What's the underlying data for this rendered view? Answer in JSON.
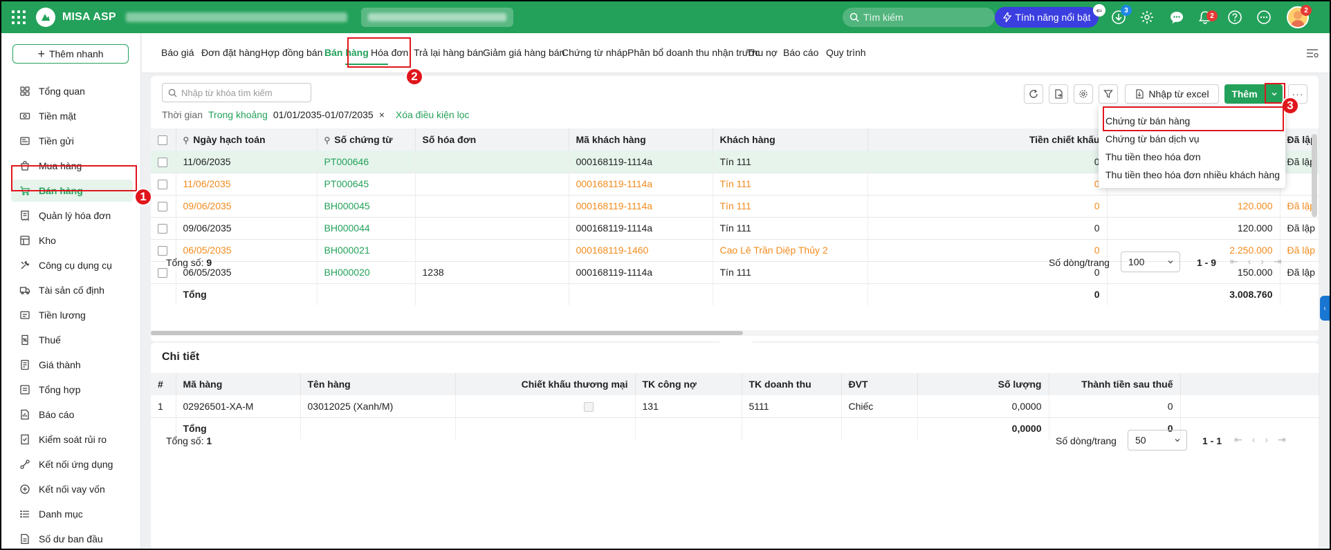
{
  "app": {
    "name": "MISA ASP"
  },
  "topbar": {
    "search_placeholder": "Tìm kiếm",
    "feature_label": "Tính năng nổi bật",
    "download_badge": "3",
    "notification_badge": "2",
    "avatar_badge": "2",
    "colors": {
      "brand": "#23a15a",
      "feature": "#3b3fe0",
      "badge": "#e53935",
      "download_badge": "#1e88e5"
    }
  },
  "sidebar": {
    "quick_add": "Thêm nhanh",
    "items": [
      {
        "label": "Tổng quan",
        "icon": "overview-icon"
      },
      {
        "label": "Tiền mặt",
        "icon": "cash-icon"
      },
      {
        "label": "Tiền gửi",
        "icon": "bank-icon"
      },
      {
        "label": "Mua hàng",
        "icon": "shopping-bag-icon"
      },
      {
        "label": "Bán hàng",
        "icon": "cart-icon"
      },
      {
        "label": "Quản lý hóa đơn",
        "icon": "invoice-icon"
      },
      {
        "label": "Kho",
        "icon": "warehouse-icon"
      },
      {
        "label": "Công cụ dụng cụ",
        "icon": "tools-icon"
      },
      {
        "label": "Tài sản cố định",
        "icon": "truck-icon"
      },
      {
        "label": "Tiền lương",
        "icon": "payroll-icon"
      },
      {
        "label": "Thuế",
        "icon": "tax-icon"
      },
      {
        "label": "Giá thành",
        "icon": "cost-icon"
      },
      {
        "label": "Tổng hợp",
        "icon": "summary-icon"
      },
      {
        "label": "Báo cáo",
        "icon": "report-icon"
      },
      {
        "label": "Kiểm soát rủi ro",
        "icon": "risk-icon"
      },
      {
        "label": "Kết nối ứng dụng",
        "icon": "connect-icon"
      },
      {
        "label": "Kết nối vay vốn",
        "icon": "loan-icon"
      },
      {
        "label": "Danh mục",
        "icon": "list-icon"
      },
      {
        "label": "Số dư ban đầu",
        "icon": "balance-icon"
      }
    ]
  },
  "tabs": [
    "Báo giá",
    "Đơn đặt hàng",
    "Hợp đồng bán",
    "Bán hàng",
    "Hóa đơn",
    "Trả lại hàng bán",
    "Giảm giá hàng bán",
    "Chứng từ nháp",
    "Phân bổ doanh thu nhận trước",
    "Thu nợ",
    "Báo cáo",
    "Quy trình"
  ],
  "toolbar": {
    "search_placeholder": "Nhập từ khóa tìm kiếm",
    "excel_label": "Nhập từ excel",
    "add_label": "Thêm",
    "more_label": "···"
  },
  "filter": {
    "label": "Thời gian",
    "mode": "Trong khoảng",
    "range": "01/01/2035-01/07/2035",
    "clear_x": "×",
    "clear_label": "Xóa điều kiện lọc"
  },
  "dropdown": {
    "options": [
      "Chứng từ bán hàng",
      "Chứng từ bán dịch vụ",
      "Thu tiền theo hóa đơn",
      "Thu tiền theo hóa đơn nhiều khách hàng"
    ]
  },
  "main_table": {
    "headers": [
      "Ngày hạch toán",
      "Số chứng từ",
      "Số hóa đơn",
      "Mã khách hàng",
      "Khách hàng",
      "Tiền chiết khấu",
      "",
      "Đã lập hó"
    ],
    "rows": [
      {
        "date": "11/06/2035",
        "doc": "PT000646",
        "invoice": "",
        "cust_code": "000168119-1114a",
        "cust": "Tín 111",
        "discount": "0",
        "amount": "",
        "status": "Đã lập"
      },
      {
        "date": "11/06/2035",
        "doc": "PT000645",
        "invoice": "",
        "cust_code": "000168119-1114a",
        "cust": "Tín 111",
        "discount": "0",
        "amount": "",
        "status": ""
      },
      {
        "date": "09/06/2035",
        "doc": "BH000045",
        "invoice": "",
        "cust_code": "000168119-1114a",
        "cust": "Tín 111",
        "discount": "0",
        "amount": "120.000",
        "status": "Đã lập"
      },
      {
        "date": "09/06/2035",
        "doc": "BH000044",
        "invoice": "",
        "cust_code": "000168119-1114a",
        "cust": "Tín 111",
        "discount": "0",
        "amount": "120.000",
        "status": "Đã lập"
      },
      {
        "date": "06/05/2035",
        "doc": "BH000021",
        "invoice": "",
        "cust_code": "000168119-1460",
        "cust": "Cao Lê Trần Diệp Thủy 2",
        "discount": "0",
        "amount": "2.250.000",
        "status": "Đã lập"
      },
      {
        "date": "06/05/2035",
        "doc": "BH000020",
        "invoice": "1238",
        "cust_code": "000168119-1114a",
        "cust": "Tín 111",
        "discount": "0",
        "amount": "150.000",
        "status": "Đã lập"
      }
    ],
    "total_label": "Tổng",
    "total_discount": "0",
    "total_amount": "3.008.760",
    "count_label": "Tổng số:",
    "count_value": "9",
    "page_size_label": "Số dòng/trang",
    "page_size": "100",
    "range": "1 - 9"
  },
  "detail": {
    "title": "Chi tiết",
    "headers": [
      "#",
      "Mã hàng",
      "Tên hàng",
      "Chiết khấu thương mại",
      "TK công nợ",
      "TK doanh thu",
      "ĐVT",
      "Số lượng",
      "Thành tiền sau thuế"
    ],
    "rows": [
      {
        "no": "1",
        "code": "02926501-XA-M",
        "name": "03012025 (Xanh/M)",
        "tk_cong_no": "131",
        "tk_doanh_thu": "5111",
        "unit": "Chiếc",
        "qty": "0,0000",
        "amount": "0"
      }
    ],
    "total_label": "Tổng",
    "total_qty": "0,0000",
    "total_amount": "0",
    "count_label": "Tổng số:",
    "count_value": "1",
    "page_size_label": "Số dòng/trang",
    "page_size": "50",
    "range": "1 - 1"
  },
  "steps": [
    "1",
    "2",
    "3"
  ]
}
